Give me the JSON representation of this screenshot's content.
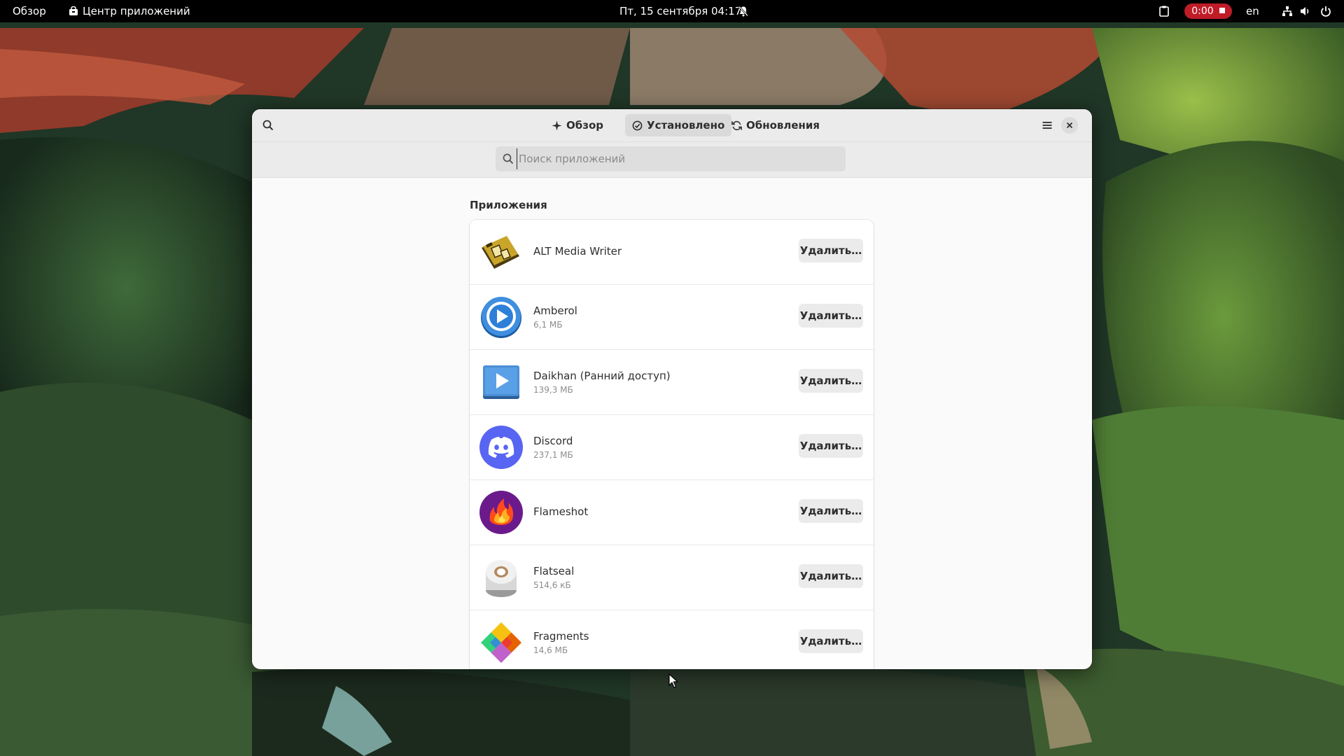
{
  "topbar": {
    "activities": "Обзор",
    "app_name": "Центр приложений",
    "clock": "Пт, 15 сентября  04:17",
    "recording_time": "0:00",
    "language": "en",
    "icons": [
      "bell-muted-icon",
      "clipboard-icon",
      "network-icon",
      "volume-icon",
      "power-icon"
    ]
  },
  "headerbar": {
    "tabs": [
      {
        "label": "Обзор",
        "icon": "sparkle-icon",
        "active": false
      },
      {
        "label": "Установлено",
        "icon": "check-circle-icon",
        "active": true
      },
      {
        "label": "Обновления",
        "icon": "refresh-icon",
        "active": false
      }
    ]
  },
  "search": {
    "placeholder": "Поиск приложений",
    "value": ""
  },
  "section": {
    "title": "Приложения"
  },
  "apps": [
    {
      "name": "ALT Media Writer",
      "size": "",
      "button": "Удалить…",
      "icon": "alt-media-writer-icon"
    },
    {
      "name": "Amberol",
      "size": "6,1 МБ",
      "button": "Удалить…",
      "icon": "amberol-icon"
    },
    {
      "name": "Daikhan (Ранний доступ)",
      "size": "139,3 МБ",
      "button": "Удалить…",
      "icon": "daikhan-icon"
    },
    {
      "name": "Discord",
      "size": "237,1 МБ",
      "button": "Удалить…",
      "icon": "discord-icon"
    },
    {
      "name": "Flameshot",
      "size": "",
      "button": "Удалить…",
      "icon": "flameshot-icon"
    },
    {
      "name": "Flatseal",
      "size": "514,6 кБ",
      "button": "Удалить…",
      "icon": "flatseal-icon"
    },
    {
      "name": "Fragments",
      "size": "14,6 МБ",
      "button": "Удалить…",
      "icon": "fragments-icon"
    }
  ],
  "colors": {
    "accent_record": "#c01c28",
    "window_bg": "#fafafa",
    "headerbar_bg": "#ebebeb"
  }
}
